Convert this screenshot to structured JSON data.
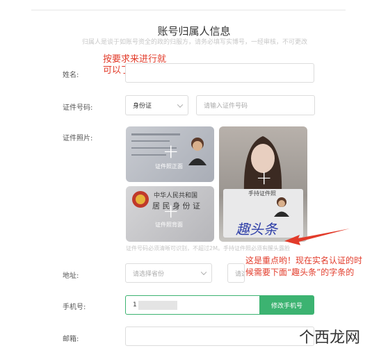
{
  "page": {
    "title": "账号归属人信息",
    "subtitle": "归属人是谈于如账号资全的政的归服方，请务必填写实博号，一经审核，不可更改"
  },
  "form": {
    "name_label": "姓名:",
    "id_type_label": "证件号码:",
    "id_type_value": "身份证",
    "id_number_placeholder": "请输入证件号码",
    "photo_label": "证件照片:",
    "card_front_caption": "证件照正面",
    "card_back_caption": "证件照背面",
    "card_hand_caption": "手持证件照",
    "id_card_header": "中华人民共和国",
    "id_card_title": "居 民 身 份 证",
    "photo_hint": "证件号码必须清晰可识别，不超过2M。手持证件照必须有醒头露脸",
    "address_label": "地址:",
    "province_placeholder": "请选择省份",
    "city_placeholder": "请选择城市",
    "phone_label": "手机号:",
    "phone_value": "1",
    "phone_button": "修改手机号",
    "email_label": "邮箱:"
  },
  "annotations": {
    "note1_line1": "按要求来进行就",
    "note1_line2": "可以了",
    "note2_line1": "这是重点哟！现在实名认证的时",
    "note2_line2": "候需要下面“趣头条”的字条的",
    "handwriting": "趣头条",
    "watermark": "个西龙网",
    "accent_color": "#3cb371",
    "annotation_color": "#e23b2a"
  }
}
